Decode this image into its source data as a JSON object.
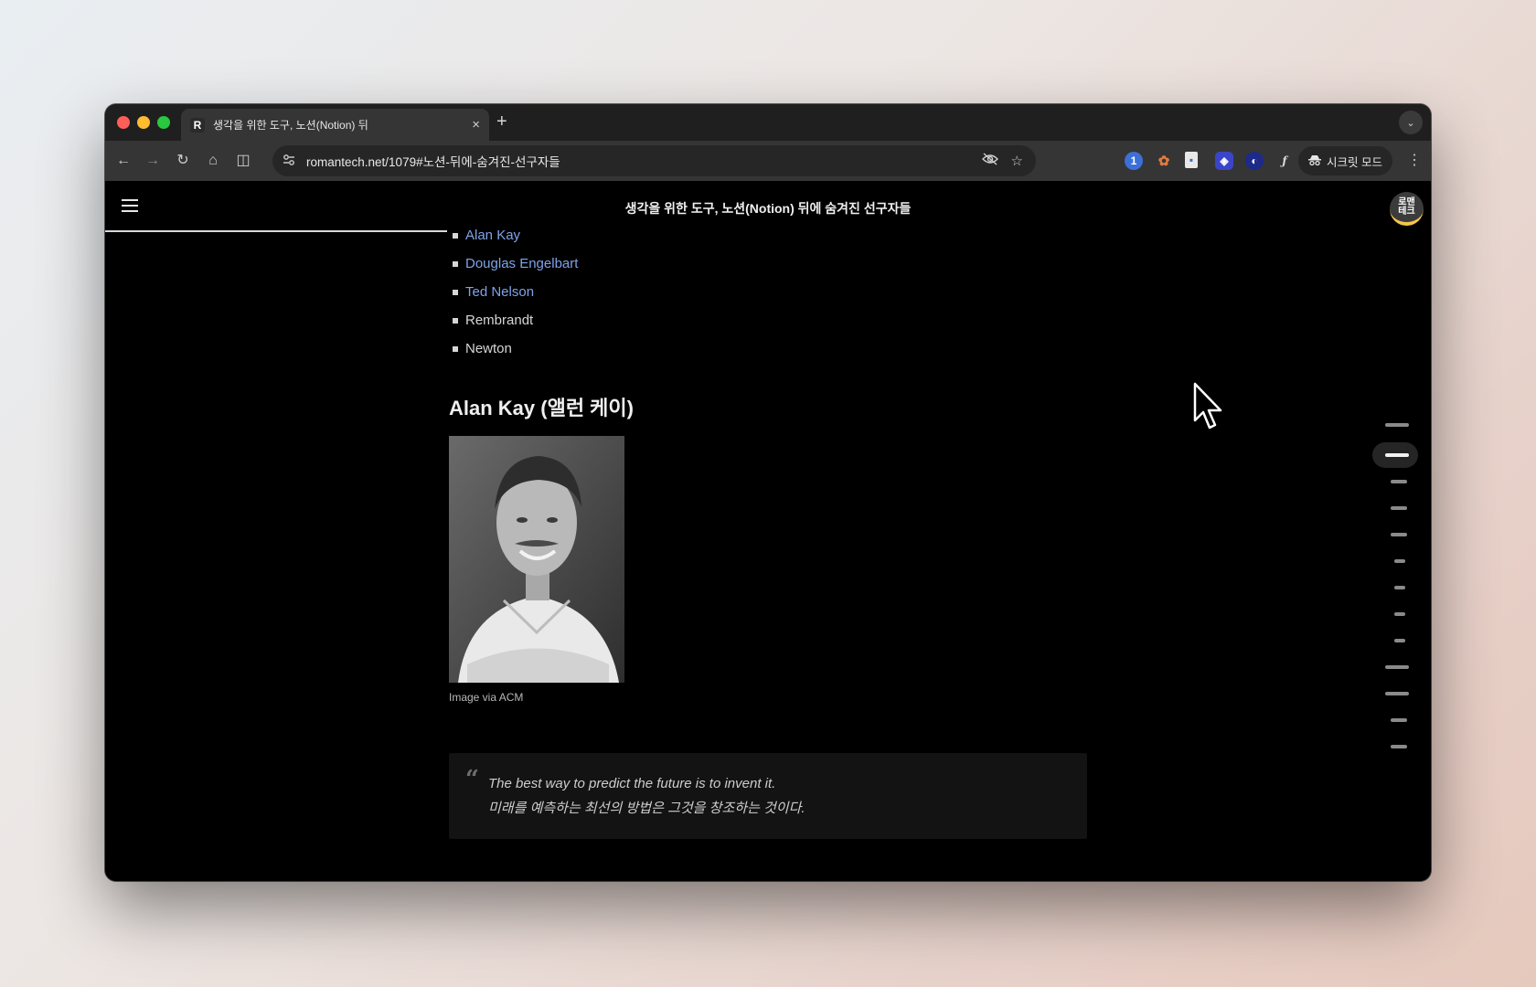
{
  "browser": {
    "tab": {
      "favicon_letter": "R",
      "title": "생각을 위한 도구, 노션(Notion) 뒤",
      "close_glyph": "×"
    },
    "new_tab_glyph": "+",
    "tab_menu_glyph": "⌄",
    "url": "romantech.net/1079#노션-뒤에-숨겨진-선구자들",
    "incognito_label": "시크릿 모드",
    "nav": {
      "back": "←",
      "forward": "→",
      "reload": "↻",
      "home": "⌂",
      "split": "◫"
    },
    "extensions": [
      "1password-icon",
      "tampermonkey-icon",
      "notes-icon",
      "bitwarden-icon",
      "orb-icon",
      "formula-icon",
      "extensions-icon"
    ],
    "menu_glyph": "⋮"
  },
  "page": {
    "header_title": "생각을 위한 도구, 노션(Notion) 뒤에 숨겨진 선구자들",
    "logo_text": "로맨\n테크",
    "reading_progress": 0.26,
    "list": [
      {
        "label": "Alan Kay",
        "link": true
      },
      {
        "label": "Douglas Engelbart",
        "link": true
      },
      {
        "label": "Ted Nelson",
        "link": true
      },
      {
        "label": "Rembrandt",
        "link": false
      },
      {
        "label": "Newton",
        "link": false
      }
    ],
    "section_title": "Alan Kay (앨런 케이)",
    "image_caption": "Image via ACM",
    "quote": {
      "mark": "“",
      "line1": "The best way to predict the future is to invent it.",
      "line2": "미래를 예측하는 최선의 방법은 그것을 창조하는 것이다."
    },
    "toc_count": 13,
    "toc_active_index": 1
  },
  "colors": {
    "link": "#7fa3e8",
    "text": "#d6d6d6",
    "background": "#000000",
    "logo_accent": "#f5c54a"
  }
}
